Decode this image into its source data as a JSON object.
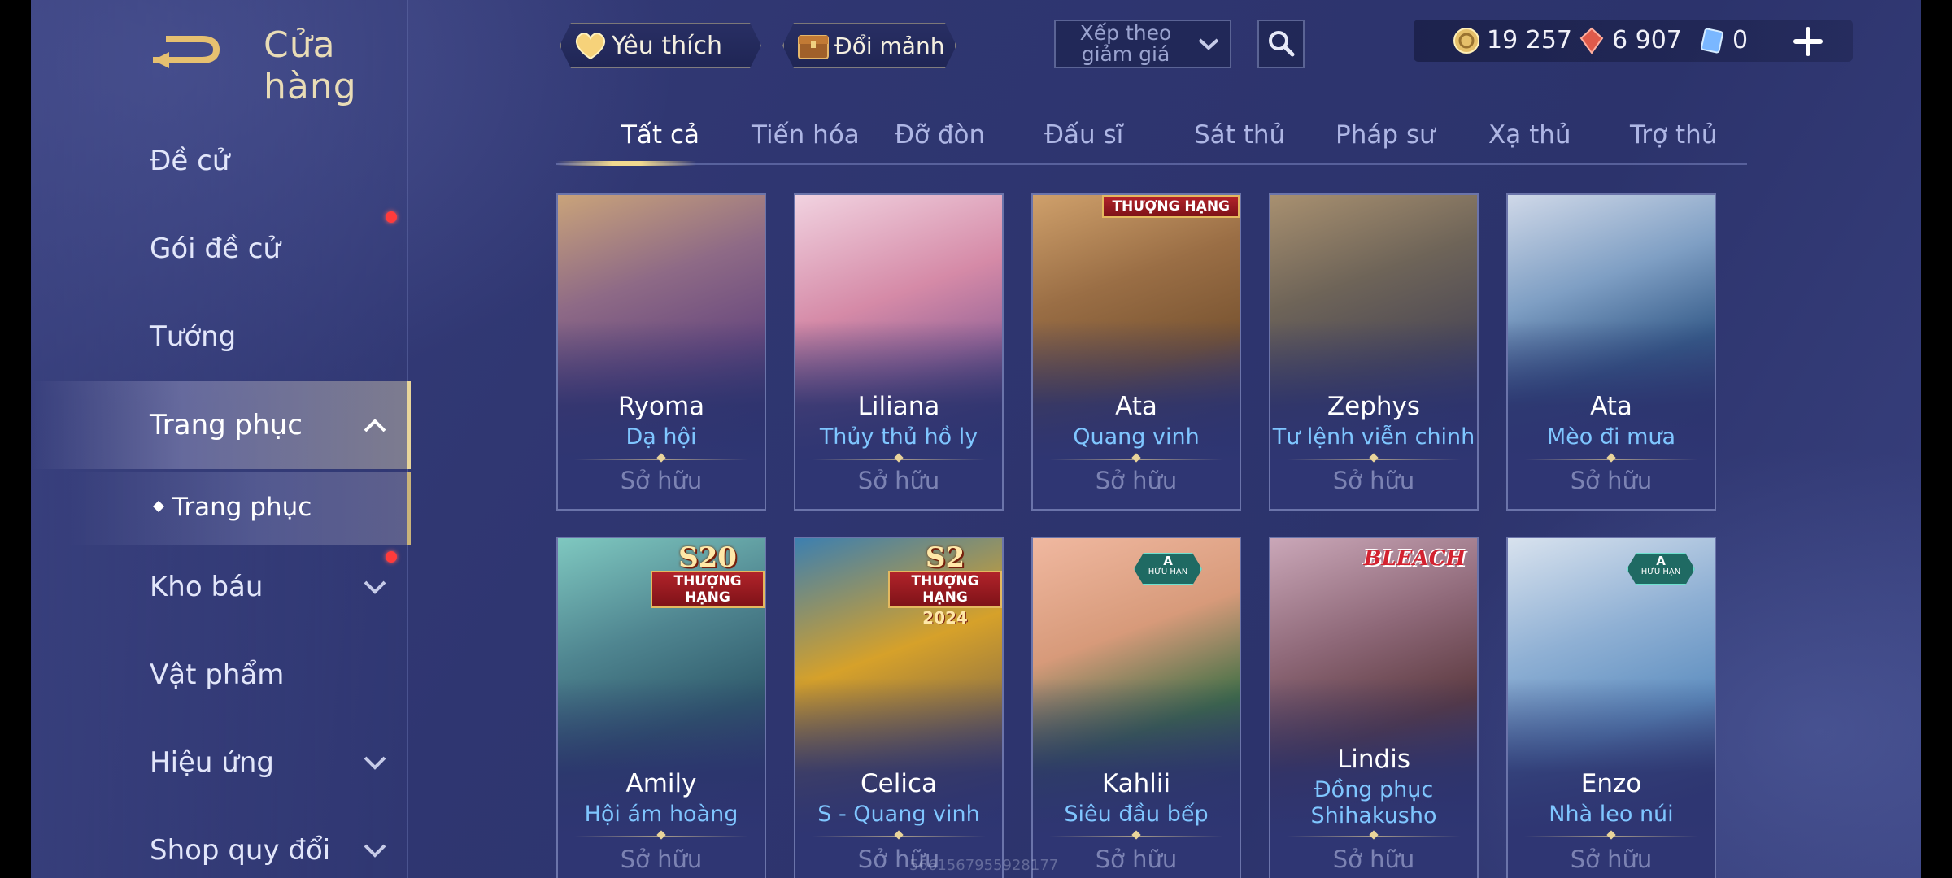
{
  "header": {
    "title": "Cửa hàng",
    "favorites_label": "Yêu thích",
    "exchange_label": "Đổi mảnh",
    "sort_label": "Xếp theo giảm giá",
    "currencies": [
      {
        "name": "gold",
        "value": "19 257",
        "color": "#e6c06a"
      },
      {
        "name": "gem",
        "value": "6 907",
        "color": "#e05a4a"
      },
      {
        "name": "voucher",
        "value": "0",
        "color": "#7ab7ff"
      }
    ]
  },
  "sidebar": {
    "items": [
      {
        "label": "Đề cử"
      },
      {
        "label": "Gói đề cử"
      },
      {
        "label": "Tướng"
      },
      {
        "label": "Trang phục"
      },
      {
        "label": "Kho báu"
      },
      {
        "label": "Vật phẩm"
      },
      {
        "label": "Hiệu ứng"
      },
      {
        "label": "Shop quy đổi"
      }
    ],
    "sub_item": {
      "label": "Trang phục"
    }
  },
  "tabs": [
    "Tất cả",
    "Tiến hóa",
    "Đỡ đòn",
    "Đấu sĩ",
    "Sát thủ",
    "Pháp sư",
    "Xạ thủ",
    "Trợ thủ"
  ],
  "cards": [
    {
      "hero": "Ryoma",
      "skin": "Dạ hội",
      "status": "Sở hữu",
      "colors": [
        "#6a4a7e",
        "#c9a37a"
      ]
    },
    {
      "hero": "Liliana",
      "skin": "Thủy thủ hồ ly",
      "status": "Sở hữu",
      "colors": [
        "#d58aa7",
        "#f1d2e0"
      ]
    },
    {
      "hero": "Ata",
      "skin": "Quang vinh",
      "status": "Sở hữu",
      "badge": "THƯỢNG HẠNG",
      "colors": [
        "#7a5532",
        "#cfa06b"
      ]
    },
    {
      "hero": "Zephys",
      "skin": "Tư lệnh viễn chinh",
      "status": "Sở hữu",
      "colors": [
        "#4e4a55",
        "#a89070"
      ]
    },
    {
      "hero": "Ata",
      "skin": "Mèo đi mưa",
      "status": "Sở hữu",
      "colors": [
        "#365c8a",
        "#cfd8e8"
      ]
    },
    {
      "hero": "Amily",
      "skin": "Hội ám hoàng",
      "status": "Sở hữu",
      "badge_big": {
        "s": "S20",
        "r": "THƯỢNG HẠNG"
      },
      "colors": [
        "#2f5a6b",
        "#7fc8c0"
      ]
    },
    {
      "hero": "Celica",
      "skin": "S - Quang vinh",
      "status": "Sở hữu",
      "badge_big": {
        "s": "S2",
        "r": "THƯỢNG HẠNG",
        "y": "2024"
      },
      "colors": [
        "#d6a12a",
        "#3c7fb0"
      ]
    },
    {
      "hero": "Kahlii",
      "skin": "Siêu đầu bếp",
      "status": "Sở hữu",
      "hex": {
        "a": "A",
        "b": "HỮU HẠN"
      },
      "colors": [
        "#d79a7a",
        "#3f6f45"
      ]
    },
    {
      "hero": "Lindis",
      "skin": "Đồng phục Shihakusho",
      "status": "Sở hữu",
      "bleach": "BLEACH",
      "colors": [
        "#caa7b8",
        "#5c3a40"
      ]
    },
    {
      "hero": "Enzo",
      "skin": "Nhà leo núi",
      "status": "Sở hữu",
      "hex": {
        "a": "A",
        "b": "HỮU HẠN"
      },
      "colors": [
        "#5f8fc0",
        "#d8e2ee"
      ]
    }
  ],
  "watermark": "5661567955928177"
}
